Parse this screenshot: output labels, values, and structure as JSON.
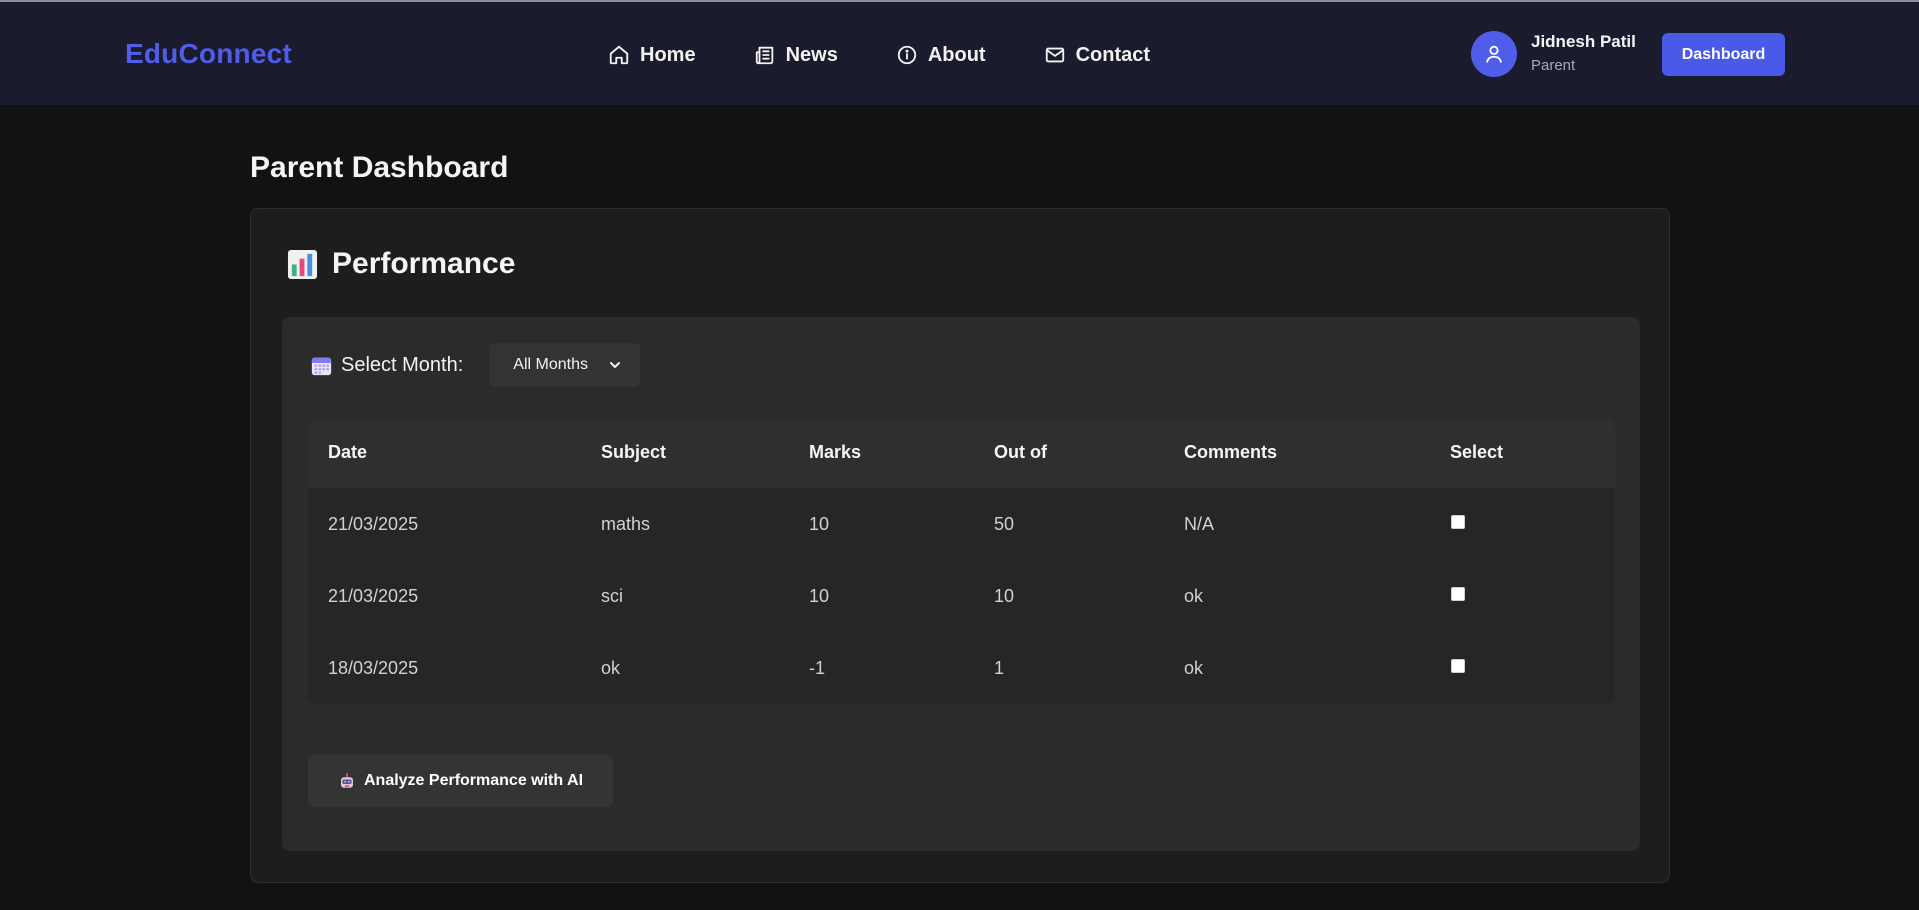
{
  "header": {
    "logo": "EduConnect",
    "nav": [
      {
        "label": "Home",
        "icon": "home-icon"
      },
      {
        "label": "News",
        "icon": "newspaper-icon"
      },
      {
        "label": "About",
        "icon": "info-icon"
      },
      {
        "label": "Contact",
        "icon": "mail-icon"
      }
    ],
    "user": {
      "name": "Jidnesh Patil",
      "role": "Parent",
      "icon": "user-icon"
    },
    "dashboard_button": "Dashboard"
  },
  "page": {
    "title": "Parent Dashboard"
  },
  "performance": {
    "title": "Performance",
    "title_icon": "bar-chart-icon",
    "month_filter": {
      "label": "Select Month:",
      "icon": "calendar-icon",
      "selected": "All Months"
    },
    "table": {
      "columns": [
        "Date",
        "Subject",
        "Marks",
        "Out of",
        "Comments",
        "Select"
      ],
      "rows": [
        {
          "date": "21/03/2025",
          "subject": "maths",
          "marks": "10",
          "out_of": "50",
          "comments": "N/A",
          "selected": false
        },
        {
          "date": "21/03/2025",
          "subject": "sci",
          "marks": "10",
          "out_of": "10",
          "comments": "ok",
          "selected": false
        },
        {
          "date": "18/03/2025",
          "subject": "ok",
          "marks": "-1",
          "out_of": "1",
          "comments": "ok",
          "selected": false
        }
      ]
    },
    "ai_button": {
      "label": "Analyze Performance with AI",
      "icon": "robot-icon"
    }
  },
  "colors": {
    "accent": "#4f5de8",
    "header_bg": "#1b1b2e",
    "page_bg": "#121212",
    "card_bg": "#1d1d1d",
    "inner_card_bg": "#2b2b2b"
  }
}
